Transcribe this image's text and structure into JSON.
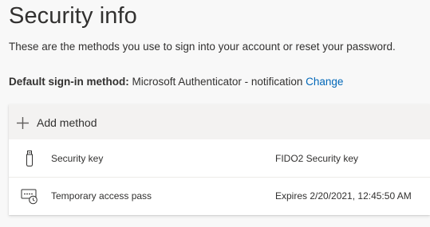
{
  "header": {
    "title": "Security info",
    "description": "These are the methods you use to sign into your account or reset your password."
  },
  "default_method": {
    "label": "Default sign-in method:",
    "value": "Microsoft Authenticator - notification",
    "change_label": "Change"
  },
  "methods_card": {
    "add_method_label": "Add method",
    "add_method_icon": "plus-icon",
    "methods": [
      {
        "icon": "usb-key-icon",
        "name": "Security key",
        "detail": "FIDO2 Security key"
      },
      {
        "icon": "temporary-pass-icon",
        "name": "Temporary access pass",
        "detail": "Expires 2/20/2021, 12:45:50 AM"
      }
    ]
  },
  "colors": {
    "link": "#0067b8",
    "text": "#323130",
    "page_background": "#f8f8f8",
    "card_header": "#f3f2f1"
  }
}
